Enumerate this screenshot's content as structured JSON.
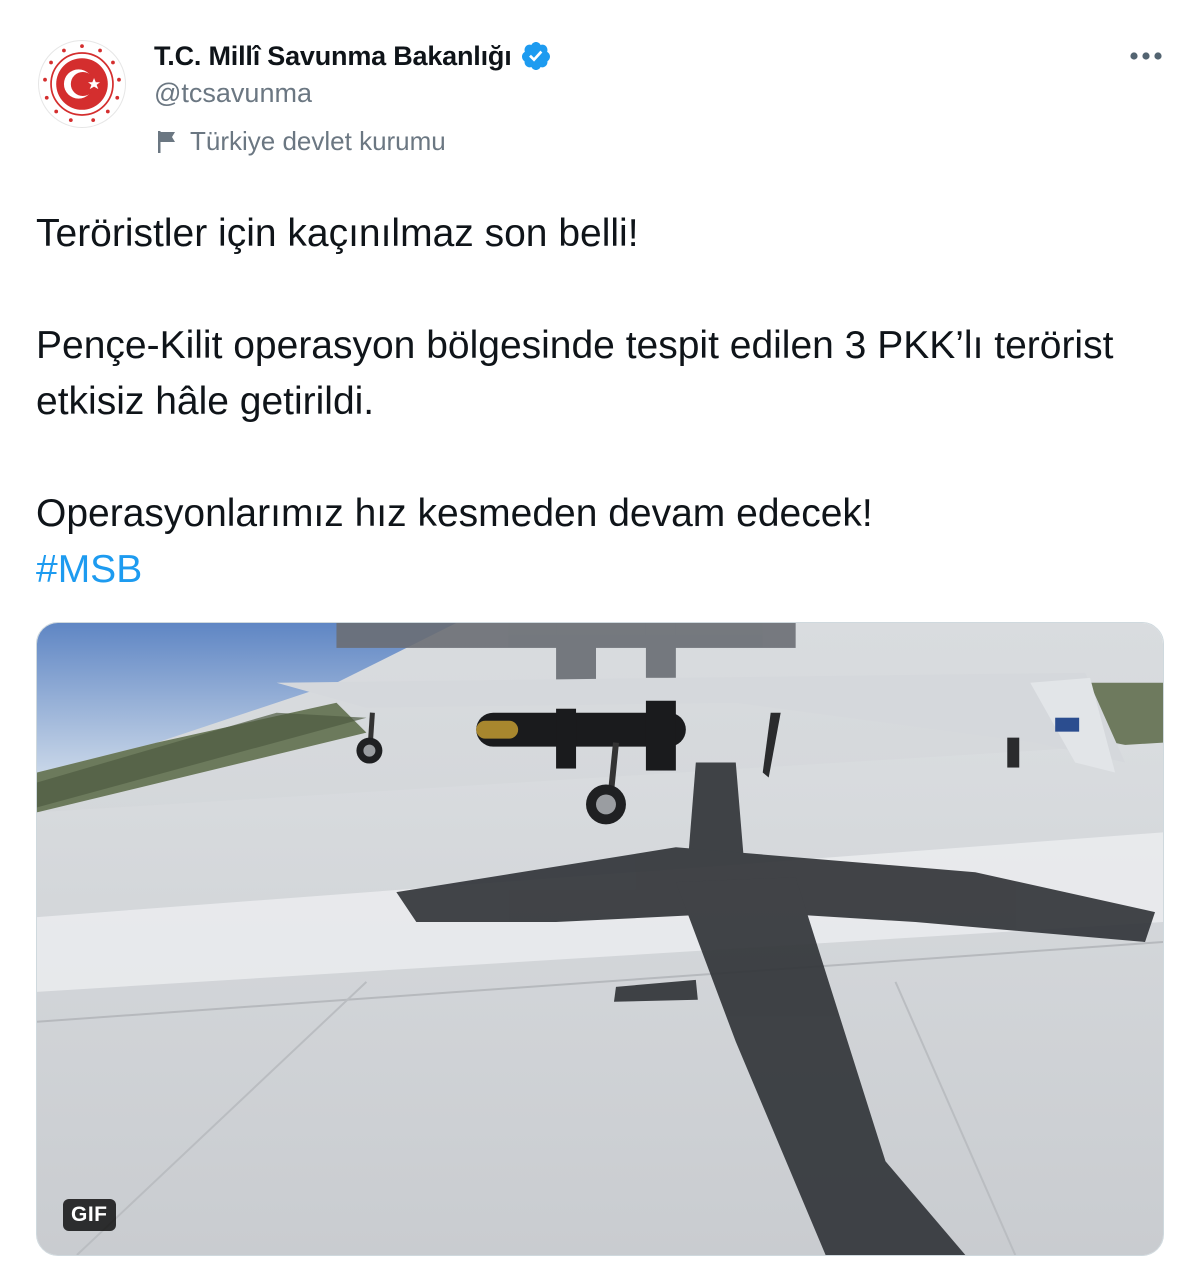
{
  "author": {
    "display_name": "T.C. Millî Savunma Bakanlığı",
    "handle": "@tcsavunma",
    "label": "Türkiye devlet kurumu",
    "avatar_icon": "ministry-emblem-icon",
    "verified_icon": "verified-badge-icon",
    "label_icon": "flag-icon"
  },
  "menu": {
    "more_icon": "more-options-icon"
  },
  "tweet": {
    "lines": [
      "Teröristler için kaçınılmaz son belli!",
      "Pençe-Kilit operasyon bölgesinde tespit edilen 3 PKK’lı terörist etkisiz hâle getirildi.",
      "Operasyonlarımız hız kesmeden devam edecek!"
    ],
    "hashtag": "#MSB"
  },
  "media": {
    "badge": "GIF"
  },
  "colors": {
    "link": "#1d9bf0",
    "verified": "#1d9bf0",
    "secondary_text": "#6b7782",
    "emblem_red": "#d42e2e"
  }
}
